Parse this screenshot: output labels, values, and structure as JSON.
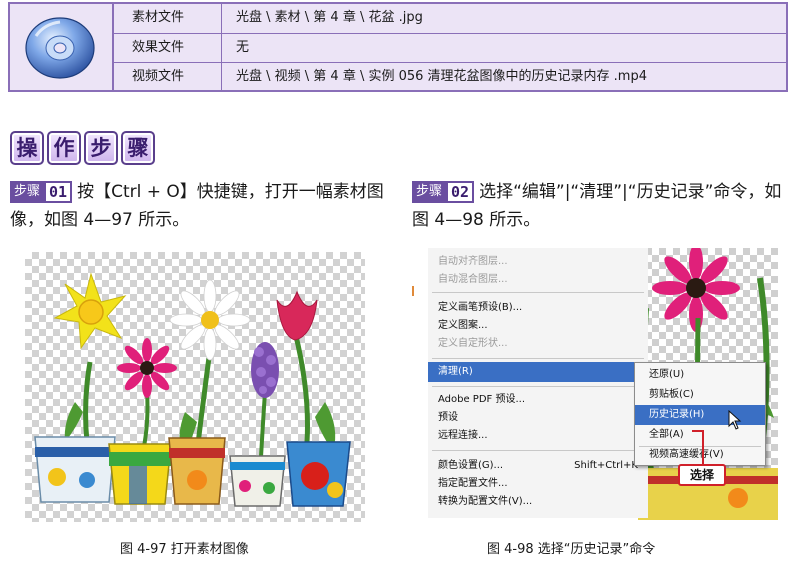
{
  "info_table": {
    "rows": [
      {
        "key": "素材文件",
        "value": "光盘 \\ 素材 \\ 第 4 章 \\ 花盆 .jpg"
      },
      {
        "key": "效果文件",
        "value": "无"
      },
      {
        "key": "视频文件",
        "value": "光盘 \\ 视频 \\ 第 4 章 \\ 实例 056    清理花盆图像中的历史记录内存 .mp4"
      }
    ]
  },
  "steps_header": [
    "操",
    "作",
    "步",
    "骤"
  ],
  "step1": {
    "badge_label": "步骤",
    "badge_num": "01",
    "text": "按【Ctrl + O】快捷键，打开一幅素材图像，如图 4—97 所示。"
  },
  "step2": {
    "badge_label": "步骤",
    "badge_num": "02",
    "text": "选择“编辑”|“清理”|“历史记录”命令，如图 4—98 所示。"
  },
  "menu": {
    "items": [
      {
        "label": "自动对齐图层...",
        "disabled": true
      },
      {
        "label": "自动混合图层...",
        "disabled": true
      },
      {
        "label": "定义画笔预设(B)..."
      },
      {
        "label": "定义图案..."
      },
      {
        "label": "定义自定形状...",
        "disabled": true
      },
      {
        "label": "清理(R)",
        "submenu": true,
        "highlight": true
      },
      {
        "label": "Adobe PDF 预设..."
      },
      {
        "label": "预设",
        "submenu": true
      },
      {
        "label": "远程连接..."
      },
      {
        "label": "颜色设置(G)...",
        "shortcut": "Shift+Ctrl+K"
      },
      {
        "label": "指定配置文件..."
      },
      {
        "label": "转换为配置文件(V)..."
      }
    ]
  },
  "submenu": {
    "items": [
      {
        "label": "还原(U)"
      },
      {
        "label": "剪贴板(C)"
      },
      {
        "label": "历史记录(H)",
        "highlight": true
      },
      {
        "label": "全部(A)"
      },
      {
        "label": "视频高速缓存(V)"
      }
    ]
  },
  "callout": {
    "label": "选择"
  },
  "captions": {
    "fig97": "图 4-97    打开素材图像",
    "fig98": "图 4-98    选择“历史记录”命令"
  },
  "colors": {
    "table_border": "#8a6fb8",
    "table_fill": "#ece4f6",
    "badge_purple": "#6a4ea0",
    "menu_highlight": "#3a6fc4",
    "callout_red": "#d0202a"
  }
}
